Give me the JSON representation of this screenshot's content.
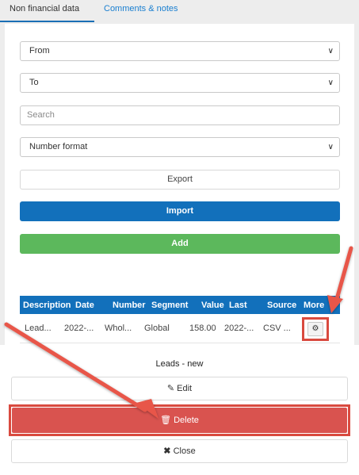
{
  "tabs": [
    {
      "label": "Non financial data",
      "active": true
    },
    {
      "label": "Comments & notes",
      "active": false
    }
  ],
  "filters": {
    "from": "From",
    "to": "To",
    "search_placeholder": "Search",
    "number_format": "Number format"
  },
  "buttons": {
    "export": "Export",
    "import": "Import",
    "add": "Add"
  },
  "table": {
    "columns": [
      "Description",
      "Date",
      "Number",
      "Segment",
      "Value",
      "Last",
      "Source",
      "More"
    ],
    "rows": [
      [
        "Lead...",
        "2022-...",
        "Whol...",
        "Global",
        "158.00",
        "2022-...",
        "CSV ..."
      ]
    ]
  },
  "sheet": {
    "title": "Leads - new",
    "edit": "Edit",
    "delete": "Delete",
    "close": "Close"
  },
  "colors": {
    "primary": "#1270bb",
    "success": "#5cb85c",
    "danger": "#d9534f",
    "highlight": "#d94a3f"
  },
  "icons": {
    "edit": "pencil-icon",
    "delete": "trash-icon",
    "close": "x-icon",
    "more": "gears-icon"
  }
}
